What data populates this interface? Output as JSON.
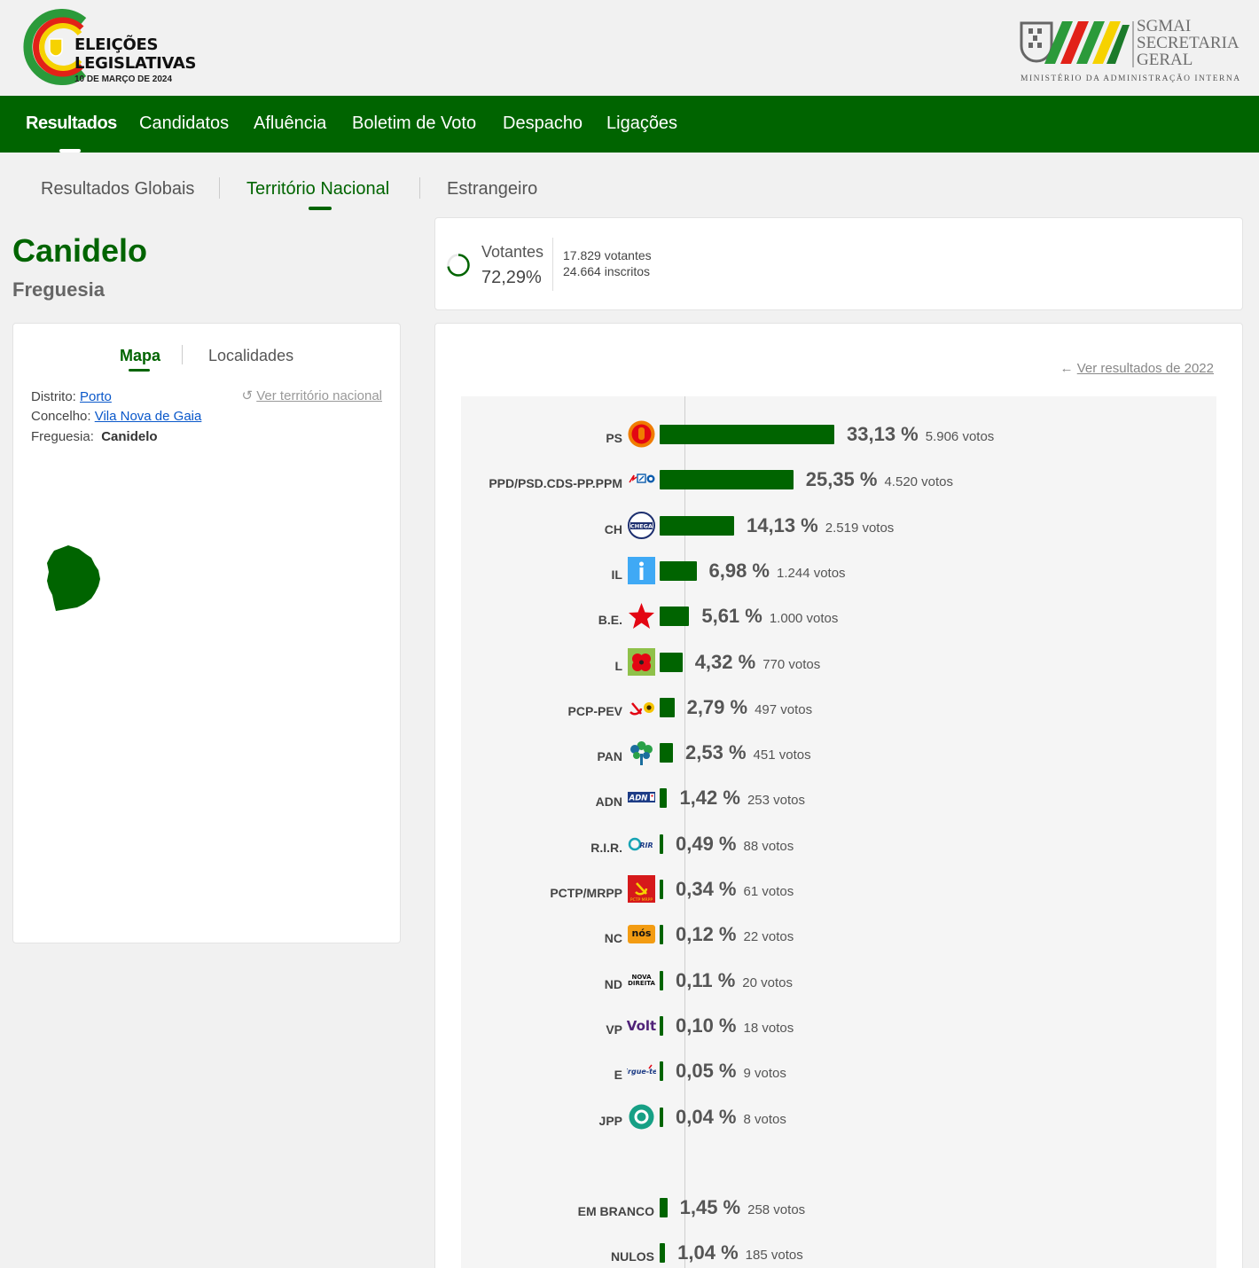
{
  "header": {
    "logo_line1": "ELEIÇÕES",
    "logo_line2": "LEGISLATIVAS",
    "logo_date": "10 DE MARÇO DE 2024",
    "sgmai_line1": "SGMAI",
    "sgmai_line2": "SECRETARIA",
    "sgmai_line3": "GERAL",
    "ministry": "MINISTÉRIO DA ADMINISTRAÇÃO INTERNA"
  },
  "nav": {
    "items": [
      "Resultados",
      "Candidatos",
      "Afluência",
      "Boletim de Voto",
      "Despacho",
      "Ligações"
    ],
    "active": "Resultados"
  },
  "subtabs": {
    "items": [
      "Resultados Globais",
      "Território Nacional",
      "Estrangeiro"
    ],
    "active": "Território Nacional"
  },
  "place": {
    "name": "Canidelo",
    "type": "Freguesia"
  },
  "voters": {
    "label": "Votantes",
    "percent": "72,29%",
    "percent_value": 72.29,
    "count": "17.829 votantes",
    "registered": "24.664 inscritos"
  },
  "map_panel": {
    "tabs": [
      "Mapa",
      "Localidades"
    ],
    "active": "Mapa",
    "distrito_label": "Distrito:",
    "distrito": "Porto",
    "concelho_label": "Concelho:",
    "concelho": "Vila Nova de Gaia",
    "freguesia_label": "Freguesia:",
    "freguesia": "Canidelo",
    "ver_nacional": "Ver território nacional"
  },
  "results": {
    "ver_2022": "Ver resultados de 2022"
  },
  "chart_data": {
    "type": "bar",
    "orientation": "horizontal",
    "categories": [
      "PS",
      "PPD/PSD.CDS-PP.PPM",
      "CH",
      "IL",
      "B.E.",
      "L",
      "PCP-PEV",
      "PAN",
      "ADN",
      "R.I.R.",
      "PCTP/MRPP",
      "NC",
      "ND",
      "VP",
      "E",
      "JPP",
      "EM BRANCO",
      "NULOS"
    ],
    "values": [
      33.13,
      25.35,
      14.13,
      6.98,
      5.61,
      4.32,
      2.79,
      2.53,
      1.42,
      0.49,
      0.34,
      0.12,
      0.11,
      0.1,
      0.05,
      0.04,
      1.45,
      1.04
    ],
    "pct_labels": [
      "33,13 %",
      "25,35 %",
      "14,13 %",
      "6,98 %",
      "5,61 %",
      "4,32 %",
      "2,79 %",
      "2,53 %",
      "1,42 %",
      "0,49 %",
      "0,34 %",
      "0,12 %",
      "0,11 %",
      "0,10 %",
      "0,05 %",
      "0,04 %",
      "1,45 %",
      "1,04 %"
    ],
    "votes_labels": [
      "5.906 votos",
      "4.520 votos",
      "2.519 votos",
      "1.244 votos",
      "1.000 votos",
      "770 votos",
      "497 votos",
      "451 votos",
      "253 votos",
      "88 votos",
      "61 votos",
      "22 votos",
      "20 votos",
      "18 votos",
      "9 votos",
      "8 votos",
      "258 votos",
      "185 votos"
    ],
    "logos": [
      "ps-logo-icon",
      "ad-logo-icon",
      "chega-logo-icon",
      "il-logo-icon",
      "be-logo-icon",
      "livre-logo-icon",
      "cdu-logo-icon",
      "pan-logo-icon",
      "adn-logo-icon",
      "rir-logo-icon",
      "pctp-logo-icon",
      "nos-cidadaos-logo-icon",
      "nova-direita-logo-icon",
      "volt-logo-icon",
      "ergue-te-logo-icon",
      "jpp-logo-icon",
      "",
      ""
    ],
    "logo_text": [
      "",
      "",
      "CHEGA",
      "i",
      "",
      "",
      "",
      "",
      "ADN",
      "RIR",
      "PCTP MRPP",
      "nós",
      "NOVA DIREITA",
      "Volt",
      "Ergue-te",
      "",
      "",
      ""
    ],
    "bar_color": "#006400"
  }
}
